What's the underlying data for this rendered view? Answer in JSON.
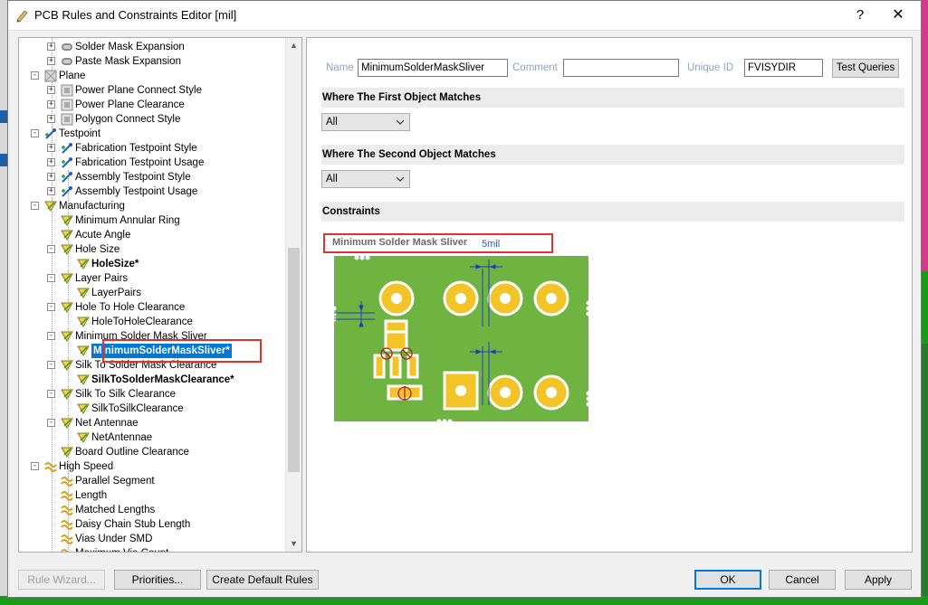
{
  "window": {
    "title": "PCB Rules and Constraints Editor [mil]",
    "help_glyph": "?",
    "close_glyph": "✕"
  },
  "tree": {
    "items": [
      {
        "label": "Solder Mask Expansion",
        "icon": "mask-rule-icon",
        "expander": "+",
        "bold": false
      },
      {
        "label": "Paste Mask Expansion",
        "icon": "mask-rule-icon",
        "expander": "+",
        "bold": false
      },
      {
        "label": "Plane",
        "icon": "plane-category-icon",
        "expander": "−",
        "bold": false
      },
      {
        "label": "Power Plane Connect Style",
        "icon": "plane-rule-icon",
        "expander": "+",
        "bold": false
      },
      {
        "label": "Power Plane Clearance",
        "icon": "plane-rule-icon",
        "expander": "+",
        "bold": false
      },
      {
        "label": "Polygon Connect Style",
        "icon": "plane-rule-icon",
        "expander": "+",
        "bold": false
      },
      {
        "label": "Testpoint",
        "icon": "testpoint-category-icon",
        "expander": "−",
        "bold": false
      },
      {
        "label": "Fabrication Testpoint Style",
        "icon": "testpoint-rule-icon",
        "expander": "+",
        "bold": false
      },
      {
        "label": "Fabrication Testpoint Usage",
        "icon": "testpoint-rule-icon",
        "expander": "+",
        "bold": false
      },
      {
        "label": "Assembly Testpoint Style",
        "icon": "testpoint-rule-icon",
        "expander": "+",
        "bold": false
      },
      {
        "label": "Assembly Testpoint Usage",
        "icon": "testpoint-rule-icon",
        "expander": "+",
        "bold": false
      },
      {
        "label": "Manufacturing",
        "icon": "manufacturing-category-icon",
        "expander": "−",
        "bold": false
      },
      {
        "label": "Minimum Annular Ring",
        "icon": "manufacturing-rule-icon",
        "expander": "",
        "bold": false
      },
      {
        "label": "Acute Angle",
        "icon": "manufacturing-rule-icon",
        "expander": "",
        "bold": false
      },
      {
        "label": "Hole Size",
        "icon": "manufacturing-rule-icon",
        "expander": "−",
        "bold": false
      },
      {
        "label": "HoleSize*",
        "icon": "rule-instance-icon",
        "expander": "",
        "bold": true
      },
      {
        "label": "Layer Pairs",
        "icon": "manufacturing-rule-icon",
        "expander": "−",
        "bold": false
      },
      {
        "label": "LayerPairs",
        "icon": "rule-instance-icon",
        "expander": "",
        "bold": false
      },
      {
        "label": "Hole To Hole Clearance",
        "icon": "manufacturing-rule-icon",
        "expander": "−",
        "bold": false
      },
      {
        "label": "HoleToHoleClearance",
        "icon": "rule-instance-icon",
        "expander": "",
        "bold": false
      },
      {
        "label": "Minimum Solder Mask Sliver",
        "icon": "manufacturing-rule-icon",
        "expander": "−",
        "bold": false
      },
      {
        "label": "MinimumSolderMaskSliver*",
        "icon": "rule-instance-icon",
        "expander": "",
        "bold": true,
        "selected": true
      },
      {
        "label": "Silk To Solder Mask Clearance",
        "icon": "manufacturing-rule-icon",
        "expander": "−",
        "bold": false
      },
      {
        "label": "SilkToSolderMaskClearance*",
        "icon": "rule-instance-icon",
        "expander": "",
        "bold": true
      },
      {
        "label": "Silk To Silk Clearance",
        "icon": "manufacturing-rule-icon",
        "expander": "−",
        "bold": false
      },
      {
        "label": "SilkToSilkClearance",
        "icon": "rule-instance-icon",
        "expander": "",
        "bold": false
      },
      {
        "label": "Net Antennae",
        "icon": "manufacturing-rule-icon",
        "expander": "−",
        "bold": false
      },
      {
        "label": "NetAntennae",
        "icon": "rule-instance-icon",
        "expander": "",
        "bold": false
      },
      {
        "label": "Board Outline Clearance",
        "icon": "manufacturing-rule-icon",
        "expander": "",
        "bold": false
      },
      {
        "label": "High Speed",
        "icon": "highspeed-category-icon",
        "expander": "−",
        "bold": false
      },
      {
        "label": "Parallel Segment",
        "icon": "highspeed-rule-icon",
        "expander": "",
        "bold": false
      },
      {
        "label": "Length",
        "icon": "highspeed-rule-icon",
        "expander": "",
        "bold": false
      },
      {
        "label": "Matched Lengths",
        "icon": "highspeed-rule-icon",
        "expander": "",
        "bold": false
      },
      {
        "label": "Daisy Chain Stub Length",
        "icon": "highspeed-rule-icon",
        "expander": "",
        "bold": false
      },
      {
        "label": "Vias Under SMD",
        "icon": "highspeed-rule-icon",
        "expander": "",
        "bold": false
      },
      {
        "label": "Maximum Via Count",
        "icon": "highspeed-rule-icon",
        "expander": "",
        "bold": false
      }
    ]
  },
  "rule": {
    "name_label": "Name",
    "name_value": "MinimumSolderMaskSliver",
    "comment_label": "Comment",
    "comment_value": "",
    "uid_label": "Unique ID",
    "uid_value": "FVISYDIR",
    "test_queries": "Test Queries"
  },
  "first_match": {
    "header": "Where The First Object Matches",
    "value": "All"
  },
  "second_match": {
    "header": "Where The Second Object Matches",
    "value": "All"
  },
  "constraints": {
    "header": "Constraints",
    "label": "Minimum Solder Mask Sliver",
    "value": "5mil"
  },
  "buttons": {
    "rule_wizard": "Rule Wizard...",
    "priorities": "Priorities...",
    "create_default": "Create Default Rules",
    "ok": "OK",
    "cancel": "Cancel",
    "apply": "Apply"
  },
  "colors": {
    "board_green": "#6fb441",
    "pad_gold": "#f2c428",
    "dimension_blue": "#1f3fbf",
    "selection_blue": "#0078d7",
    "highlight_red": "#e03030"
  }
}
